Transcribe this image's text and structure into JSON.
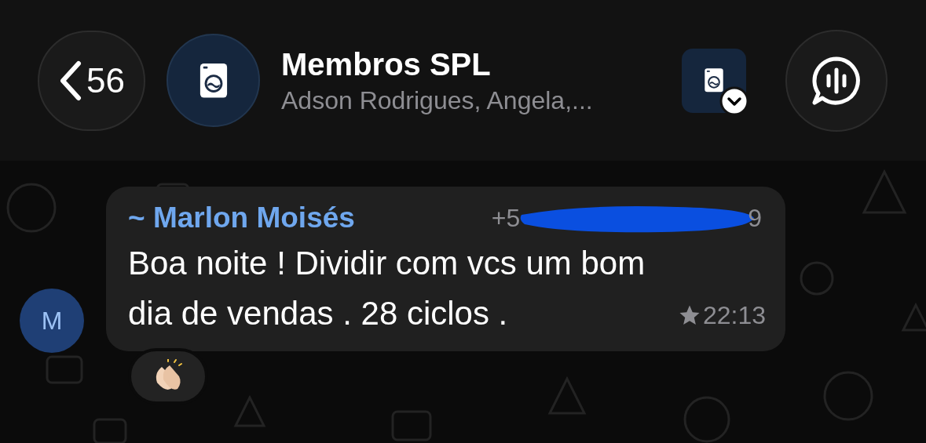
{
  "header": {
    "back_count": "56",
    "title": "Membros SPL",
    "subtitle": "Adson Rodrigues, Angela,..."
  },
  "message": {
    "avatar_letter": "M",
    "sender": "~ Marlon Moisés",
    "phone_start": "+5",
    "phone_end": "9",
    "text": "Boa noite ! Dividir com vcs um bom dia de vendas . 28 ciclos .",
    "starred": true,
    "time": "22:13"
  }
}
